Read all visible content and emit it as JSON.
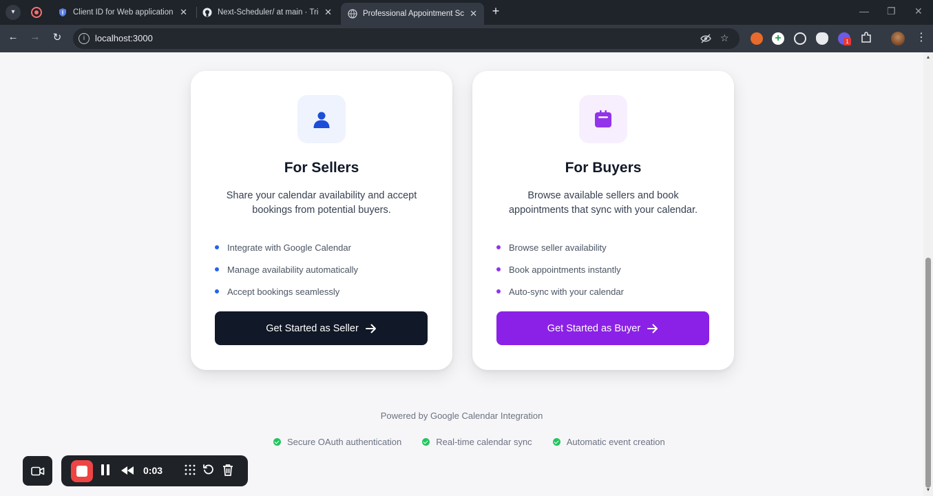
{
  "browser": {
    "tabs": [
      {
        "title": "Client ID for Web application – ",
        "icon": "shield-icon"
      },
      {
        "title": "Next-Scheduler/ at main · Triden",
        "icon": "github-icon"
      },
      {
        "title": "Professional Appointment Schedu",
        "icon": "globe-icon",
        "active": true
      }
    ],
    "url": "localhost:3000",
    "extension_badge": "1"
  },
  "sellers": {
    "title": "For Sellers",
    "description": "Share your calendar availability and accept bookings from potential buyers.",
    "features": [
      "Integrate with Google Calendar",
      "Manage availability automatically",
      "Accept bookings seamlessly"
    ],
    "cta": "Get Started as Seller",
    "accent": "#2563eb"
  },
  "buyers": {
    "title": "For Buyers",
    "description": "Browse available sellers and book appointments that sync with your calendar.",
    "features": [
      "Browse seller availability",
      "Book appointments instantly",
      "Auto-sync with your calendar"
    ],
    "cta": "Get Started as Buyer",
    "accent": "#8b21e6"
  },
  "footer": {
    "powered": "Powered by Google Calendar Integration",
    "badges": [
      "Secure OAuth authentication",
      "Real-time calendar sync",
      "Automatic event creation"
    ]
  },
  "recorder": {
    "time": "0:03"
  }
}
